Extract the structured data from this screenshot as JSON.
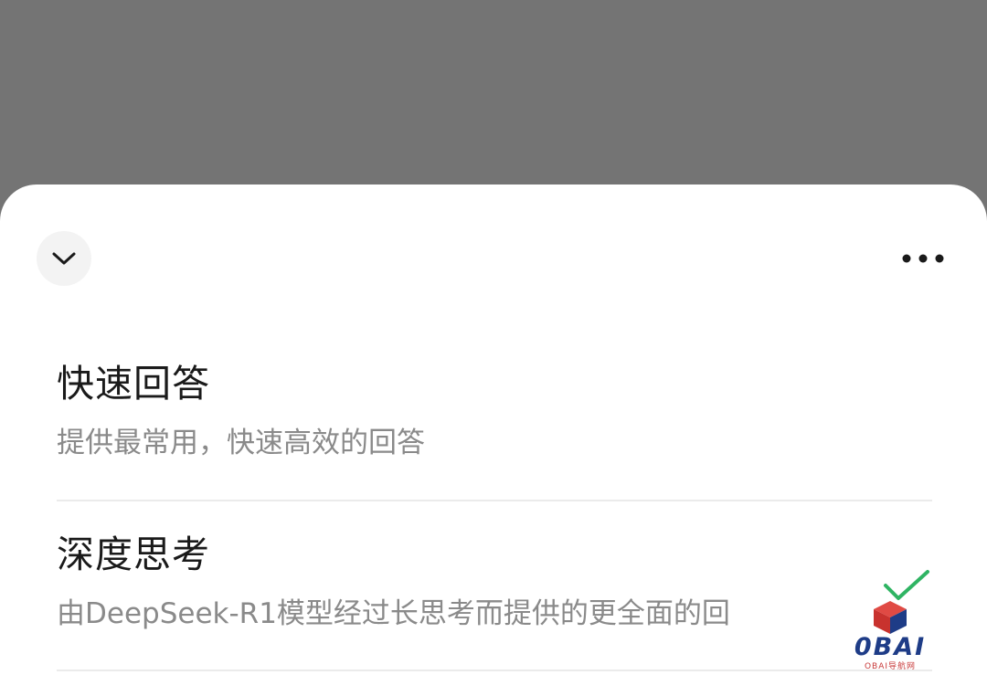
{
  "sheet": {
    "options": [
      {
        "title": "快速回答",
        "description": "提供最常用，快速高效的回答",
        "selected": false
      },
      {
        "title": "深度思考",
        "description": "由DeepSeek-R1模型经过长思考而提供的更全面的回",
        "selected": true
      }
    ],
    "icons": {
      "collapse": "chevron-down-icon",
      "more": "more-horizontal-icon",
      "selected": "checkmark-icon"
    }
  },
  "watermark": {
    "brand": "0BAI",
    "subtitle": "OBAI导航网"
  },
  "colors": {
    "backdrop": "#747474",
    "sheet": "#ffffff",
    "check": "#2fb463",
    "watermark_blue": "#1e3c87",
    "watermark_red": "#c83a3a"
  }
}
